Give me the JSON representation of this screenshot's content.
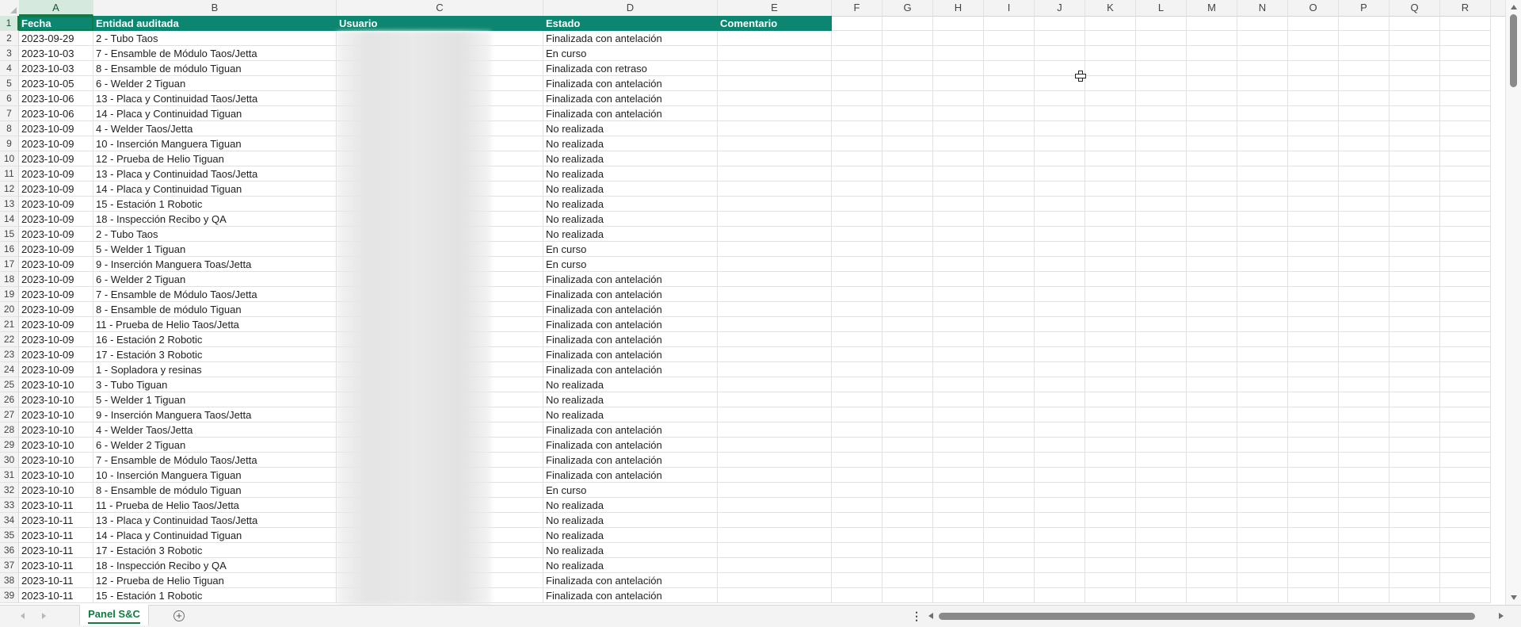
{
  "columns": [
    "A",
    "B",
    "C",
    "D",
    "E",
    "F",
    "G",
    "H",
    "I",
    "J",
    "K",
    "L",
    "M",
    "N",
    "O",
    "P",
    "Q",
    "R"
  ],
  "active_column": "A",
  "header": [
    "Fecha",
    "Entidad auditada",
    "Usuario",
    "Estado",
    "Comentario"
  ],
  "rows": [
    [
      "2023-09-29",
      "2 - Tubo Taos",
      "Finalizada con antelación"
    ],
    [
      "2023-10-03",
      "7 - Ensamble de Módulo Taos/Jetta",
      "En curso"
    ],
    [
      "2023-10-03",
      "8 - Ensamble de módulo Tiguan",
      "Finalizada con retraso"
    ],
    [
      "2023-10-05",
      "6 - Welder 2 Tiguan",
      "Finalizada con antelación"
    ],
    [
      "2023-10-06",
      "13 - Placa y Continuidad Taos/Jetta",
      "Finalizada con antelación"
    ],
    [
      "2023-10-06",
      "14 - Placa y Continuidad Tiguan",
      "Finalizada con antelación"
    ],
    [
      "2023-10-09",
      "4 - Welder Taos/Jetta",
      "No realizada"
    ],
    [
      "2023-10-09",
      "10 - Inserción Manguera Tiguan",
      "No realizada"
    ],
    [
      "2023-10-09",
      "12 - Prueba de Helio Tiguan",
      "No realizada"
    ],
    [
      "2023-10-09",
      "13 - Placa y Continuidad Taos/Jetta",
      "No realizada"
    ],
    [
      "2023-10-09",
      "14 - Placa y Continuidad Tiguan",
      "No realizada"
    ],
    [
      "2023-10-09",
      "15 - Estación 1 Robotic",
      "No realizada"
    ],
    [
      "2023-10-09",
      "18 - Inspección Recibo y QA",
      "No realizada"
    ],
    [
      "2023-10-09",
      "2 - Tubo Taos",
      "No realizada"
    ],
    [
      "2023-10-09",
      "5 - Welder 1 Tiguan",
      "En curso"
    ],
    [
      "2023-10-09",
      "9 - Inserción Manguera Toas/Jetta",
      "En curso"
    ],
    [
      "2023-10-09",
      "6 - Welder 2 Tiguan",
      "Finalizada con antelación"
    ],
    [
      "2023-10-09",
      "7 - Ensamble de Módulo Taos/Jetta",
      "Finalizada con antelación"
    ],
    [
      "2023-10-09",
      "8 - Ensamble de módulo Tiguan",
      "Finalizada con antelación"
    ],
    [
      "2023-10-09",
      "11 - Prueba de Helio Taos/Jetta",
      "Finalizada con antelación"
    ],
    [
      "2023-10-09",
      "16 - Estación 2 Robotic",
      "Finalizada con antelación"
    ],
    [
      "2023-10-09",
      "17 - Estación 3 Robotic",
      "Finalizada con antelación"
    ],
    [
      "2023-10-09",
      "1 - Sopladora y resinas",
      "Finalizada con antelación"
    ],
    [
      "2023-10-10",
      "3 - Tubo Tiguan",
      "No realizada"
    ],
    [
      "2023-10-10",
      "5 - Welder 1 Tiguan",
      "No realizada"
    ],
    [
      "2023-10-10",
      "9 - Inserción Manguera Taos/Jetta",
      "No realizada"
    ],
    [
      "2023-10-10",
      "4 - Welder Taos/Jetta",
      "Finalizada con antelación"
    ],
    [
      "2023-10-10",
      "6 - Welder 2 Tiguan",
      "Finalizada con antelación"
    ],
    [
      "2023-10-10",
      "7 - Ensamble de Módulo Taos/Jetta",
      "Finalizada con antelación"
    ],
    [
      "2023-10-10",
      "10 - Inserción Manguera Tiguan",
      "Finalizada con antelación"
    ],
    [
      "2023-10-10",
      "8 - Ensamble de módulo Tiguan",
      "En curso"
    ],
    [
      "2023-10-11",
      "11 - Prueba de Helio Taos/Jetta",
      "No realizada"
    ],
    [
      "2023-10-11",
      "13 - Placa y Continuidad Taos/Jetta",
      "No realizada"
    ],
    [
      "2023-10-11",
      "14 - Placa y Continuidad Tiguan",
      "No realizada"
    ],
    [
      "2023-10-11",
      "17 - Estación 3 Robotic",
      "No realizada"
    ],
    [
      "2023-10-11",
      "18 - Inspección Recibo y QA",
      "No realizada"
    ],
    [
      "2023-10-11",
      "12 - Prueba de Helio Tiguan",
      "Finalizada con antelación"
    ],
    [
      "2023-10-11",
      "15 - Estación 1 Robotic",
      "Finalizada con antelación"
    ]
  ],
  "sheet_tab": "Panel S&C",
  "add_sheet": "+",
  "more": "⋮",
  "icons": [
    "nav-prev-icon",
    "nav-next-icon",
    "add-sheet-icon",
    "cell-cursor-icon"
  ],
  "colors": {
    "header_fill": "#0c8670",
    "accent": "#107c41"
  }
}
